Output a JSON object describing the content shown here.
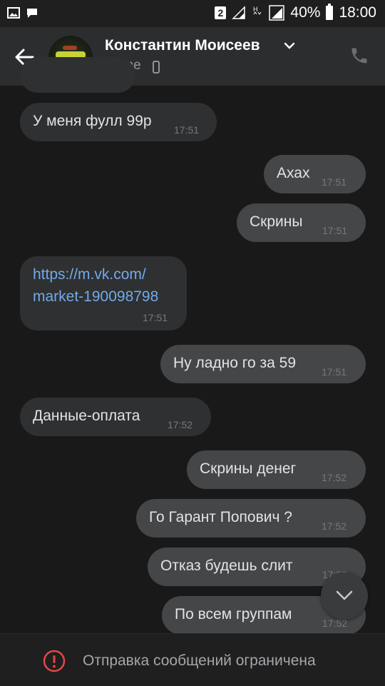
{
  "status_bar": {
    "sim_badge": "2",
    "battery": "40%",
    "time": "18:00"
  },
  "header": {
    "name": "Константин Моисеев",
    "status": "online"
  },
  "messages": [
    {
      "text": "У меня фулл 99р",
      "time": "17:51",
      "out": false
    },
    {
      "text": "Ахах",
      "time": "17:51",
      "out": true
    },
    {
      "text": "Скрины",
      "time": "17:51",
      "out": true
    },
    {
      "text_line1": "https://m.vk.com/",
      "text_line2": "market-190098798",
      "time": "17:51",
      "out": false
    },
    {
      "text": "Ну ладно го за 59",
      "time": "17:51",
      "out": true
    },
    {
      "text": "Данные-оплата",
      "time": "17:52",
      "out": false
    },
    {
      "text": "Скрины денег",
      "time": "17:52",
      "out": true
    },
    {
      "text": "Го Гарант Попович ?",
      "time": "17:52",
      "out": true
    },
    {
      "text": "Отказ будешь слит",
      "time": "17:52",
      "out": true
    },
    {
      "text": "По всем группам",
      "time": "17:52",
      "out": true
    }
  ],
  "bottom": {
    "restriction_text": "Отправка сообщений ограничена"
  },
  "colors": {
    "background": "#19191a",
    "incoming_bubble": "#2f3031",
    "outgoing_bubble": "#454647",
    "link": "#71aaeb",
    "warning": "#e64646"
  },
  "icons": [
    "image-icon",
    "chat-icon",
    "signal-icon",
    "battery-icon",
    "back-arrow-icon",
    "chevron-down-icon",
    "phone-small-icon",
    "call-icon",
    "scroll-down-icon",
    "warning-icon"
  ]
}
